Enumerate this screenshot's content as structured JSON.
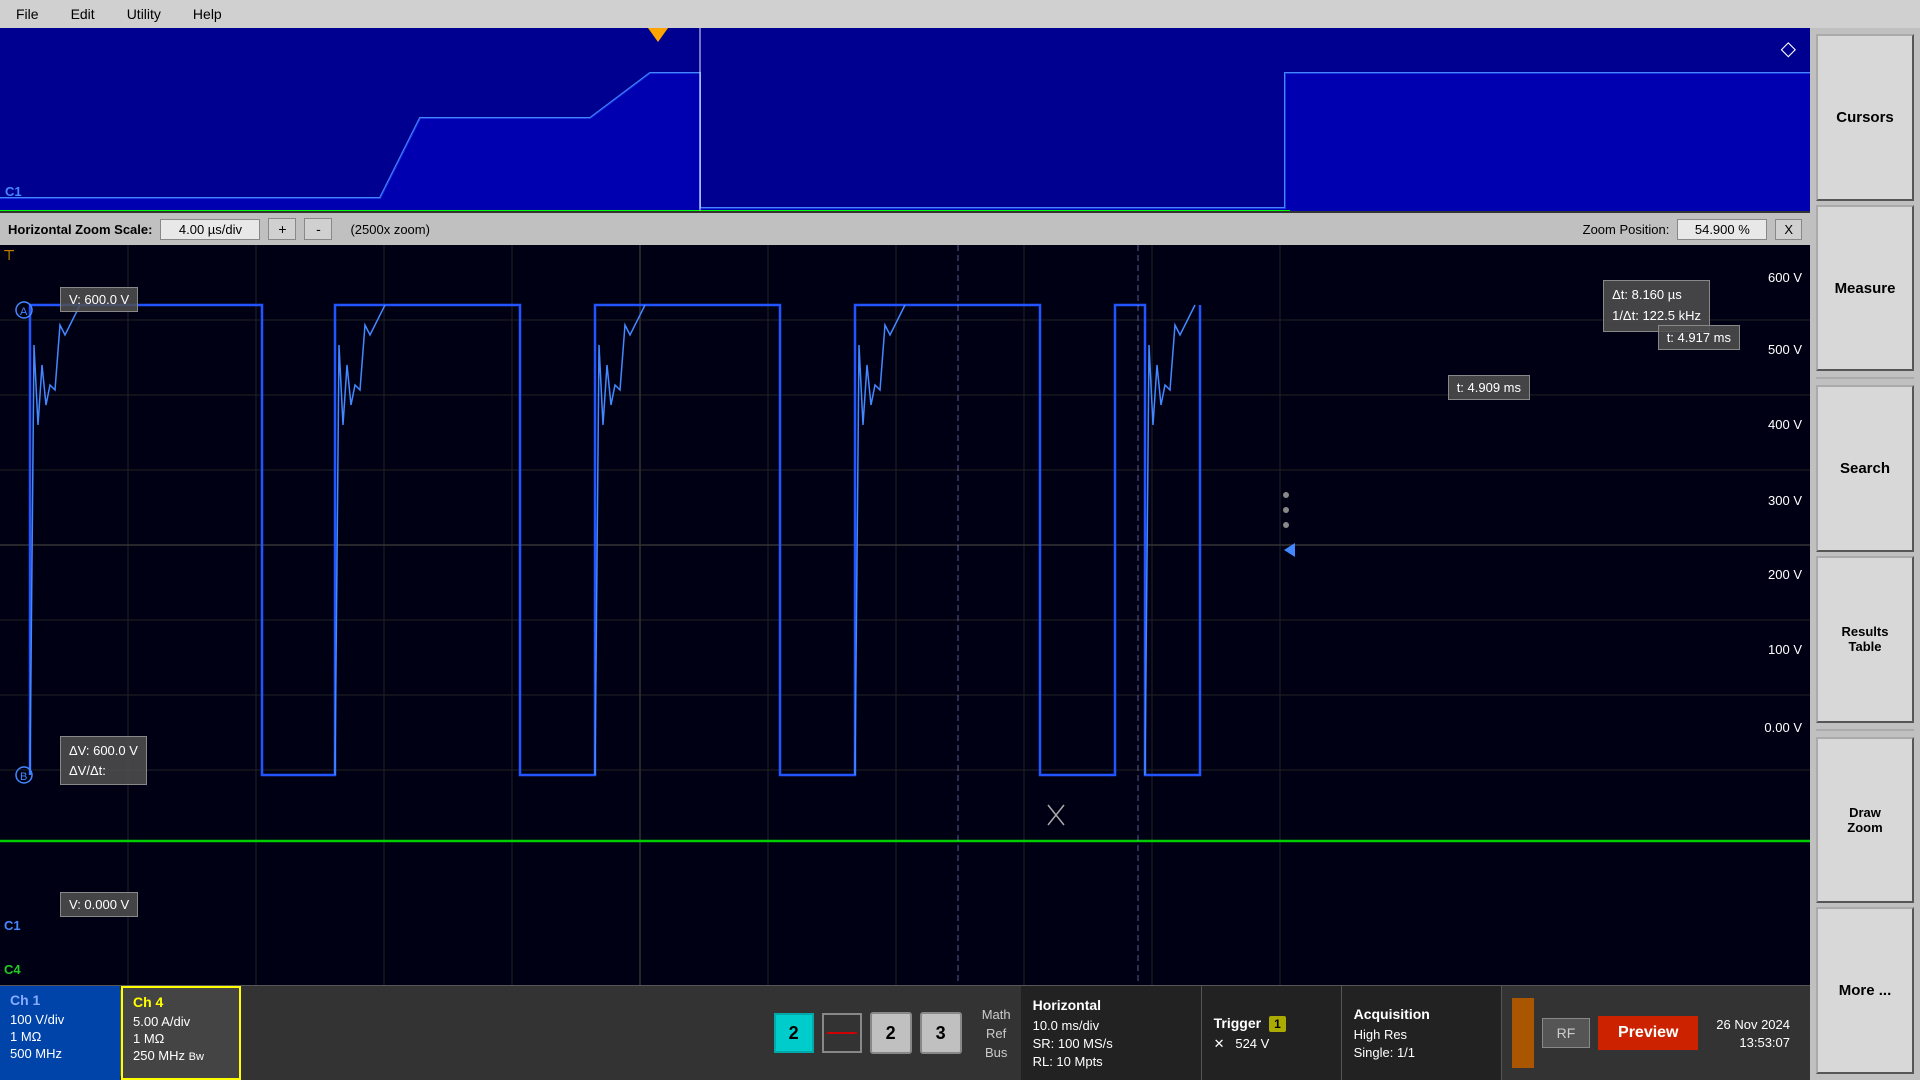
{
  "menu": {
    "items": [
      "File",
      "Edit",
      "Utility",
      "Help"
    ]
  },
  "right_panel": {
    "cursors_label": "Cursors",
    "measure_label": "Measure",
    "search_label": "Search",
    "results_table_label": "Results\nTable",
    "draw_zoom_label": "Draw\nZoom",
    "more_label": "More ..."
  },
  "overview": {
    "trigger_position": "660px",
    "zoom_icon": "◇"
  },
  "zoom_bar": {
    "label": "Horizontal Zoom Scale:",
    "scale_value": "4.00 µs/div",
    "plus_label": "+",
    "minus_label": "-",
    "zoom_info": "(2500x zoom)",
    "position_label": "Zoom Position:",
    "position_value": "54.900 %",
    "x_label": "X"
  },
  "waveform": {
    "voltage_top": "V:  600.0 V",
    "voltage_bottom": "V:  0.000 V",
    "delta_v": "ΔV:      600.0 V",
    "delta_v_dt": "ΔV/Δt:",
    "cursor_dt": "Δt:  8.160 µs",
    "cursor_inv_dt": "1/Δt: 122.5 kHz",
    "cursor_t1": "t:  4.917 ms",
    "cursor_t2": "t:  4.909 ms",
    "v_scale_600": "600 V",
    "v_scale_500": "500 V",
    "v_scale_400": "400 V",
    "v_scale_300": "300 V",
    "v_scale_200": "200 V",
    "v_scale_100": "100 V",
    "v_scale_0": "0.00 V"
  },
  "channel_labels": {
    "ch1": "C1",
    "ch4": "C4",
    "a_marker": "A",
    "b_marker": "B"
  },
  "status_bar": {
    "ch1": {
      "name": "Ch 1",
      "vdiv": "100 V/div",
      "impedance": "1 MΩ",
      "bandwidth": "500 MHz"
    },
    "ch4": {
      "name": "Ch 4",
      "vdiv": "5.00 A/div",
      "impedance": "1 MΩ",
      "bandwidth": "250 MHz",
      "bandwidth_suffix": "Bw"
    },
    "num_btns": [
      "2",
      "3"
    ],
    "math_ref_bus": [
      "Math",
      "Ref",
      "Bus"
    ],
    "horizontal": {
      "title": "Horizontal",
      "timebase": "10.0 ms/div",
      "sr": "SR: 100 MS/s",
      "rl": "RL: 10 Mpts"
    },
    "trigger": {
      "title": "Trigger",
      "symbol": "✕",
      "level": "524 V",
      "number": "1"
    },
    "acquisition": {
      "title": "Acquisition",
      "mode": "High Res",
      "sequence": "Single: 1/1"
    },
    "rf_label": "RF",
    "preview_label": "Preview",
    "date": "26 Nov 2024",
    "time": "13:53:07"
  }
}
